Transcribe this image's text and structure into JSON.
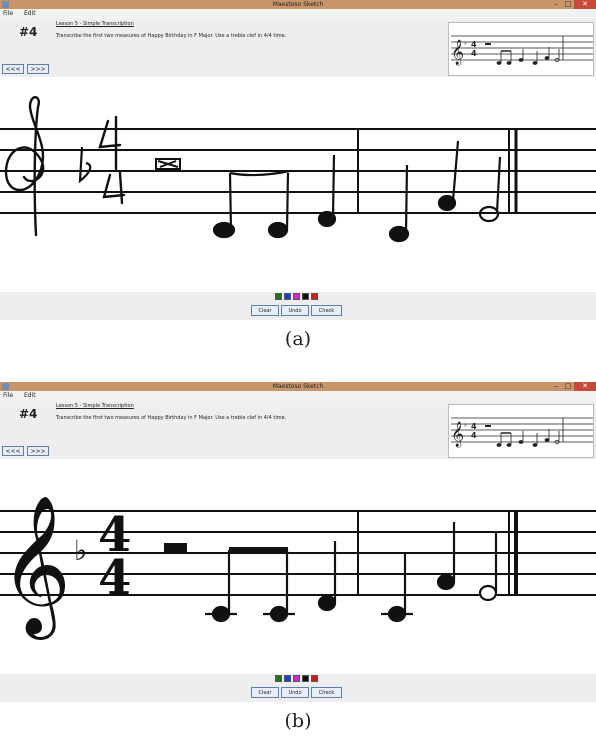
{
  "captions": {
    "a": "(a)",
    "b": "(b)"
  },
  "window": {
    "title": "Maestoso Sketch",
    "minimize": "–",
    "maximize": "□",
    "close": "✕"
  },
  "menu": [
    "File",
    "Edit"
  ],
  "lesson": {
    "number": "#4",
    "title": "Lesson 5 - Simple Transcription",
    "instruction": "Transcribe the first two measures of Happy Birthday in F Major. Use a treble clef in 4/4 time."
  },
  "nav": {
    "prev": "<<<",
    "next": ">>>"
  },
  "palette": [
    {
      "name": "green",
      "color": "#1a7a1a"
    },
    {
      "name": "blue",
      "color": "#1a3fd6"
    },
    {
      "name": "magenta",
      "color": "#e020e0"
    },
    {
      "name": "black",
      "color": "#111111"
    },
    {
      "name": "red",
      "color": "#d21a1a"
    }
  ],
  "actions": {
    "clear": "Clear",
    "undo": "Undo",
    "check": "Check"
  },
  "score": {
    "key_signature": "F major",
    "time_signature": {
      "top": "4",
      "bottom": "4"
    },
    "symbols": [
      "treble-clef",
      "flat",
      "time-4-4",
      "half-rest",
      "eighth-note",
      "eighth-note",
      "quarter-note",
      "quarter-note",
      "quarter-note",
      "half-note",
      "final-barline"
    ]
  }
}
